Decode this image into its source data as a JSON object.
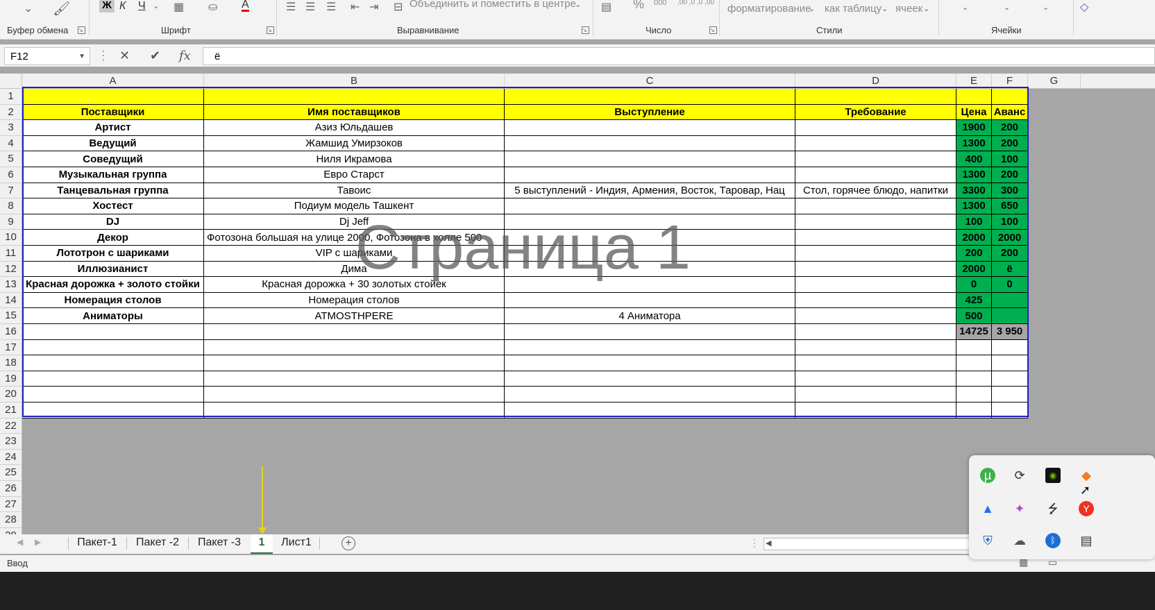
{
  "ribbon": {
    "groups": [
      {
        "name": "Буфер обмена"
      },
      {
        "name": "Шрифт"
      },
      {
        "name": "Выравнивание"
      },
      {
        "name": "Число"
      },
      {
        "name": "Стили"
      },
      {
        "name": "Ячейки"
      }
    ],
    "bold_label": "Ж",
    "italic_label": "К",
    "underline_label": "Ч",
    "font_color_label": "А",
    "merge_label": "Объединить и поместить в центре",
    "percent_label": "%",
    "thousands_label": "000",
    "dec_inc_label": ",00 ,0",
    "dec_dec_label": ",0 ,00",
    "cond_format_label": "форматирование",
    "format_table_label": "как таблицу",
    "cell_styles_label": "ячеек",
    "accent_color": "#217346"
  },
  "formula_bar": {
    "name_box": "F12",
    "cancel_label": "✕",
    "confirm_label": "✔",
    "fx_label": "fx",
    "content": "ё"
  },
  "columns": [
    "A",
    "B",
    "C",
    "D",
    "E",
    "F",
    "G"
  ],
  "rows": [
    "1",
    "2",
    "3",
    "4",
    "5",
    "6",
    "7",
    "8",
    "9",
    "10",
    "11",
    "12",
    "13",
    "14",
    "15",
    "16",
    "17",
    "18",
    "19",
    "20",
    "21",
    "22",
    "23",
    "24",
    "25",
    "26",
    "27",
    "28",
    "29"
  ],
  "table": {
    "header": {
      "A": "Поставщики",
      "B": "Имя поставщиков",
      "C": "Выступление",
      "D": "Требование",
      "E": "Цена",
      "F": "Аванс"
    },
    "data": [
      {
        "A": "Артист",
        "B": "Азиз Юльдашев",
        "C": "",
        "D": "",
        "E": "1900",
        "F": "200"
      },
      {
        "A": "Ведущий",
        "B": "Жамшид Умирзоков",
        "C": "",
        "D": "",
        "E": "1300",
        "F": "200"
      },
      {
        "A": "Соведущий",
        "B": "Ниля Икрамова",
        "C": "",
        "D": "",
        "E": "400",
        "F": "100"
      },
      {
        "A": "Музыкальная группа",
        "B": "Евро Старст",
        "C": "",
        "D": "",
        "E": "1300",
        "F": "200"
      },
      {
        "A": "Танцевальная группа",
        "B": "Тавоис",
        "C": "5 выступлений - Индия, Армения, Восток, Таровар, Нац",
        "D": "Стол, горячее блюдо, напитки",
        "E": "3300",
        "F": "300"
      },
      {
        "A": "Хостест",
        "B": "Подиум модель Ташкент",
        "C": "",
        "D": "",
        "E": "1300",
        "F": "650"
      },
      {
        "A": "DJ",
        "B": "Dj Jeff",
        "C": "",
        "D": "",
        "E": "100",
        "F": "100"
      },
      {
        "A": "Декор",
        "B": "Фотозона большая на улице 2000, Фотозона в холле 500",
        "C": "",
        "D": "",
        "E": "2000",
        "F": "2000"
      },
      {
        "A": "Лототрон  с шариками",
        "B": "VIP с шариками",
        "C": "",
        "D": "",
        "E": "200",
        "F": "200"
      },
      {
        "A": "Иллюзианист",
        "B": "Дима",
        "C": "",
        "D": "",
        "E": "2000",
        "F": "ё"
      },
      {
        "A": "Красная дорожка + золото стойки",
        "B": "Красная дорожка + 30 золотых стойек",
        "C": "",
        "D": "",
        "E": "0",
        "F": "0"
      },
      {
        "A": "Номерация столов",
        "B": "Номерация столов",
        "C": "",
        "D": "",
        "E": "425",
        "F": ""
      },
      {
        "A": "Аниматоры",
        "B": "ATMOSTHPERE",
        "C": "4 Аниматора",
        "D": "",
        "E": "500",
        "F": ""
      }
    ],
    "totals": {
      "E": "14725",
      "F": "3 950"
    }
  },
  "watermark": "Страница 1",
  "sheet_tabs": [
    {
      "label": "Пакет-1",
      "active": false
    },
    {
      "label": "Пакет -2",
      "active": false
    },
    {
      "label": "Пакет -3",
      "active": false
    },
    {
      "label": "1",
      "active": true
    },
    {
      "label": "Лист1",
      "active": false
    }
  ],
  "add_sheet_label": "+",
  "status_bar": {
    "mode": "Ввод"
  },
  "tray_icons": [
    "utorrent-icon",
    "sync-icon",
    "nvidia-icon",
    "office-icon",
    "google-drive-icon",
    "copilot-icon",
    "usb-icon",
    "yandex-icon",
    "defender-warning-icon",
    "cloud-offline-icon",
    "bluetooth-icon",
    "display-icon"
  ],
  "colors": {
    "yellow_header": "#ffff00",
    "green_price": "#00b050",
    "page_border": "#1f1fbf",
    "arrow": "#e6d21a"
  }
}
